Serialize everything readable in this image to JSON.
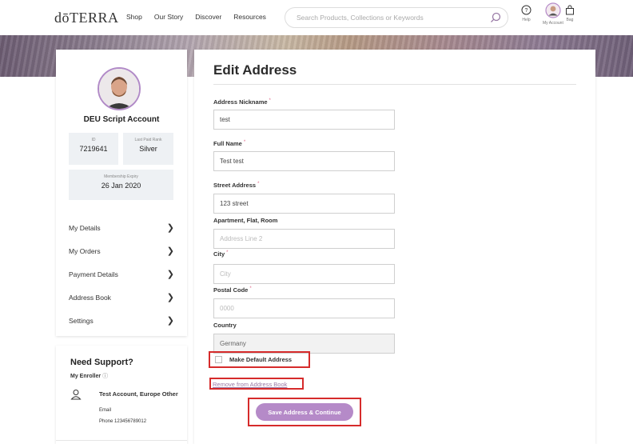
{
  "header": {
    "logo": "dōTERRA",
    "nav": [
      "Shop",
      "Our Story",
      "Discover",
      "Resources"
    ],
    "search_placeholder": "Search Products, Collections or Keywords",
    "help_label": "Help",
    "account_label": "My Account",
    "bag_label": "Bag"
  },
  "sidebar": {
    "account_name": "DEU Script Account",
    "id_label": "ID",
    "id_value": "7219641",
    "rank_label": "Last Paid Rank",
    "rank_value": "Silver",
    "membership_label": "Membership Expiry",
    "membership_value": "26 Jan 2020",
    "menu": [
      {
        "label": "My Details"
      },
      {
        "label": "My Orders"
      },
      {
        "label": "Payment Details"
      },
      {
        "label": "Address Book"
      },
      {
        "label": "Settings"
      }
    ]
  },
  "support": {
    "title": "Need Support?",
    "enroller_label": "My Enroller",
    "enroller_name": "Test Account, Europe Other",
    "email_label": "Email",
    "phone_text": "Phone 123456789012"
  },
  "form": {
    "title": "Edit Address",
    "required_mark": "*",
    "fields": {
      "nickname": {
        "label": "Address Nickname",
        "value": "test"
      },
      "full_name": {
        "label": "Full Name",
        "value": "Test test"
      },
      "street": {
        "label": "Street Address",
        "value": "123 street"
      },
      "apartment": {
        "label": "Apartment, Flat, Room",
        "value": "",
        "placeholder": "Address Line 2"
      },
      "city": {
        "label": "City",
        "value": "",
        "placeholder": "City"
      },
      "postal": {
        "label": "Postal Code",
        "value": "",
        "placeholder": "0000"
      },
      "country": {
        "label": "Country",
        "value": "Germany"
      }
    },
    "default_checkbox_label": "Make Default Address",
    "remove_link": "Remove from Address Book",
    "save_button": "Save Address & Continue"
  },
  "colors": {
    "accent": "#b58ac8",
    "link": "#9a7ba7",
    "required": "#e0698b",
    "highlight": "#d62b2b"
  }
}
